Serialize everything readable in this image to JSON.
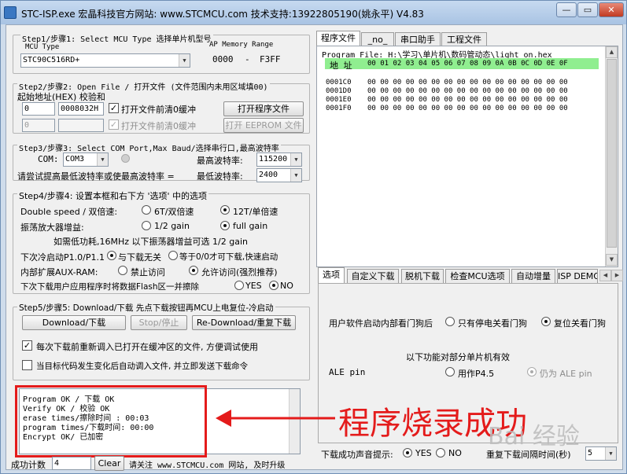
{
  "window": {
    "title": "STC-ISP.exe   宏晶科技官方网站: www.STCMCU.com  技术支持:13922805190(姚永平)  V4.83",
    "min_label": "—",
    "max_label": "▭",
    "close_label": "✕"
  },
  "step1": {
    "title": "Step1/步骤1: Select MCU Type  选择单片机型号",
    "mcu_type_label": "MCU Type",
    "mcu_value": "STC90C516RD+",
    "ap_memory_label": "AP Memory Range",
    "range_start": "0000",
    "range_sep": "-",
    "range_end": "F3FF"
  },
  "step2": {
    "title": "Step2/步骤2: Open File / 打开文件 (文件范围内未用区域填00)",
    "addr_label": "起始地址(HEX) 校验和",
    "addr1": "0",
    "checksum1": "0008032H",
    "clear_buffer1": "打开文件前清0缓冲",
    "open_program_button": "打开程序文件",
    "addr2": "0",
    "checksum2": "",
    "clear_buffer2": "打开文件前清0缓冲",
    "open_eeprom_button": "打开 EEPROM 文件"
  },
  "step3": {
    "title": "Step3/步骤3: Select COM Port,Max Baud/选择串行口,最高波特率",
    "com_label": "COM:",
    "com_value": "COM3",
    "max_baud_label": "最高波特率:",
    "max_baud_value": "115200",
    "hint": "请尝试提高最低波特率或使最高波特率 =",
    "min_baud_label": "最低波特率:",
    "min_baud_value": "2400"
  },
  "step4": {
    "title": "Step4/步骤4: 设置本框和右下方 '选项' 中的选项",
    "double_speed_label": "Double speed / 双倍速:",
    "opt_6t": "6T/双倍速",
    "opt_12t": "12T/单倍速",
    "osc_label": "振荡放大器增益:",
    "opt_half_gain": "1/2 gain",
    "opt_full_gain": "full gain",
    "osc_note": "如需低功耗,16MHz 以下振荡器增益可选 1/2 gain",
    "cold_start_label": "下次冷启动P1.0/P1.1",
    "opt_unrelated": "与下载无关",
    "opt_equal0": "等于0/0才可下载,快速启动",
    "aux_ram_label": "内部扩展AUX-RAM:",
    "opt_forbid": "禁止访问",
    "opt_allow": "允许访问(强烈推荐)",
    "flash_label": "下次下载用户应用程序时将数据Flash区一并擦除",
    "opt_yes": "YES",
    "opt_no": "NO"
  },
  "step5": {
    "title": "Step5/步骤5: Download/下载  先点下载按钮再MCU上电复位-冷启动",
    "download_button": "Download/下载",
    "stop_button": "Stop/停止",
    "redownload_button": "Re-Download/重复下载",
    "reload_check_label": "每次下载前重新调入已打开在缓冲区的文件, 方便调试使用",
    "auto_check_label": "当目标代码发生变化后自动调入文件, 并立即发送下载命令"
  },
  "log": {
    "lines": [
      "Program OK / 下载 OK",
      "Verify  OK / 校验 OK",
      "erase times/擦除时间 : 00:03",
      "program times/下载时间: 00:00",
      "Encrypt OK/ 已加密"
    ]
  },
  "status": {
    "success_label": "成功计数",
    "success_count": "4",
    "clear_button": "Clear",
    "notice": "请关注 www.STCMCU.com 网站, 及时升级"
  },
  "right_tabs": [
    "程序文件",
    "_no_",
    "串口助手",
    "工程文件"
  ],
  "hex": {
    "file_label": "Program File: H:\\学习\\单片机\\数码管动态\\light_on.hex",
    "addr_header": "地 址",
    "col_header": "00 01 02 03 04 05 06 07 08 09 0A 0B 0C 0D 0E 0F",
    "rows": [
      {
        "addr": "0001C0",
        "bytes": "00 00 00 00 00 00 00 00 00 00 00 00 00 00 00 00"
      },
      {
        "addr": "0001D0",
        "bytes": "00 00 00 00 00 00 00 00 00 00 00 00 00 00 00 00"
      },
      {
        "addr": "0001E0",
        "bytes": "00 00 00 00 00 00 00 00 00 00 00 00 00 00 00 00"
      },
      {
        "addr": "0001F0",
        "bytes": "00 00 00 00 00 00 00 00 00 00 00 00 00 00 00 00"
      }
    ]
  },
  "options_tabs": [
    "选项",
    "自定义下载",
    "脱机下载",
    "检查MCU选项",
    "自动增量",
    "ISP DEMO"
  ],
  "options": {
    "watchdog_label": "用户软件启动内部看门狗后",
    "opt_power_only": "只有停电关看门狗",
    "opt_reset_off": "复位关看门狗",
    "partial_note": "以下功能对部分单片机有效",
    "ale_label": "ALE pin",
    "opt_p45": "用作P4.5",
    "opt_ale": "仍为 ALE pin",
    "sound_label": "下载成功声音提示:",
    "sound_yes": "YES",
    "sound_no": "NO",
    "repeat_interval_label": "重复下载间隔时间(秒)",
    "repeat_interval_value": "5"
  },
  "annotation": {
    "text": "程序烧录成功",
    "watermark": "Bai 经验",
    "color": "#e41b1b"
  }
}
